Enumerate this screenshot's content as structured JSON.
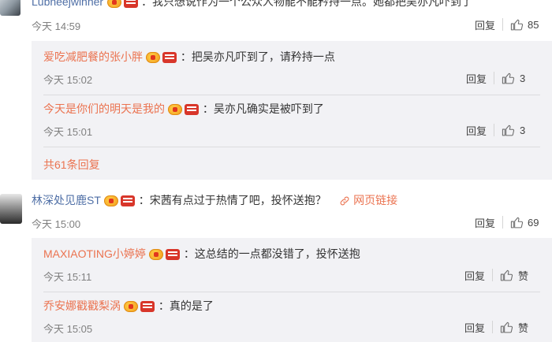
{
  "comments": [
    {
      "username": "Lubneejwinner",
      "text": "：我只想说作为一个公众人物能不能矜持一点。她都把吴亦凡吓到了",
      "time": "今天 14:59",
      "reply": "回复",
      "likes": "85",
      "replies": [
        {
          "username": "爱吃减肥餐的张小胖",
          "text": "：把吴亦凡吓到了，请矜持一点",
          "time": "今天 15:02",
          "reply": "回复",
          "likes": "3"
        },
        {
          "username": "今天是你们的明天是我的",
          "text": "：吴亦凡确实是被吓到了",
          "time": "今天 15:01",
          "reply": "回复",
          "likes": "3"
        }
      ],
      "more_replies": "共61条回复"
    },
    {
      "username": "林深处见鹿ST",
      "text": "：宋茜有点过于热情了吧，投怀送抱？",
      "weblink": "网页链接",
      "time": "今天 15:00",
      "reply": "回复",
      "likes": "69",
      "replies": [
        {
          "username": "MAXIAOTING小婷婷",
          "text": "：这总结的一点都没错了，投怀送抱",
          "time": "今天 15:11",
          "reply": "回复",
          "likes": "赞"
        },
        {
          "username": "乔安娜戳戳梨涡",
          "text": "：真的是了",
          "time": "今天 15:05",
          "reply": "回复",
          "likes": "赞"
        }
      ]
    }
  ],
  "colors": {
    "username": "#eb7350",
    "username_main": "#4f6fa6",
    "subpanel": "#f2f2f5",
    "link": "#eb7350"
  },
  "icons": [
    "vip-badge-icon",
    "level-badge-icon",
    "thumbs-up-icon",
    "link-icon"
  ]
}
